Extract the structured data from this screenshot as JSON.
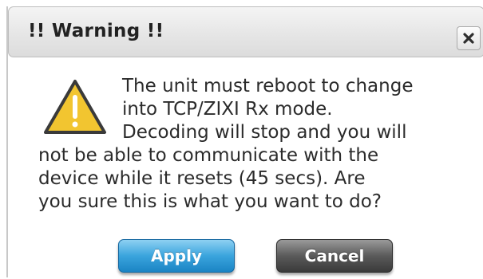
{
  "dialog": {
    "title": "!! Warning !!",
    "close_icon": "close-x-icon",
    "warning_icon": "warning-triangle-icon",
    "message_lines": [
      "The unit must reboot to change",
      "into TCP/ZIXI Rx mode.",
      "Decoding will stop and you will",
      "not be able to communicate with the",
      "device while it resets (45 secs). Are",
      "you sure this is what you want to do?"
    ],
    "buttons": {
      "apply_label": "Apply",
      "cancel_label": "Cancel"
    }
  },
  "colors": {
    "apply_button": "#3aa4dd",
    "cancel_button": "#5a5a5a",
    "warning_fill": "#f2c530",
    "title_bar": "#e6e6e6"
  }
}
